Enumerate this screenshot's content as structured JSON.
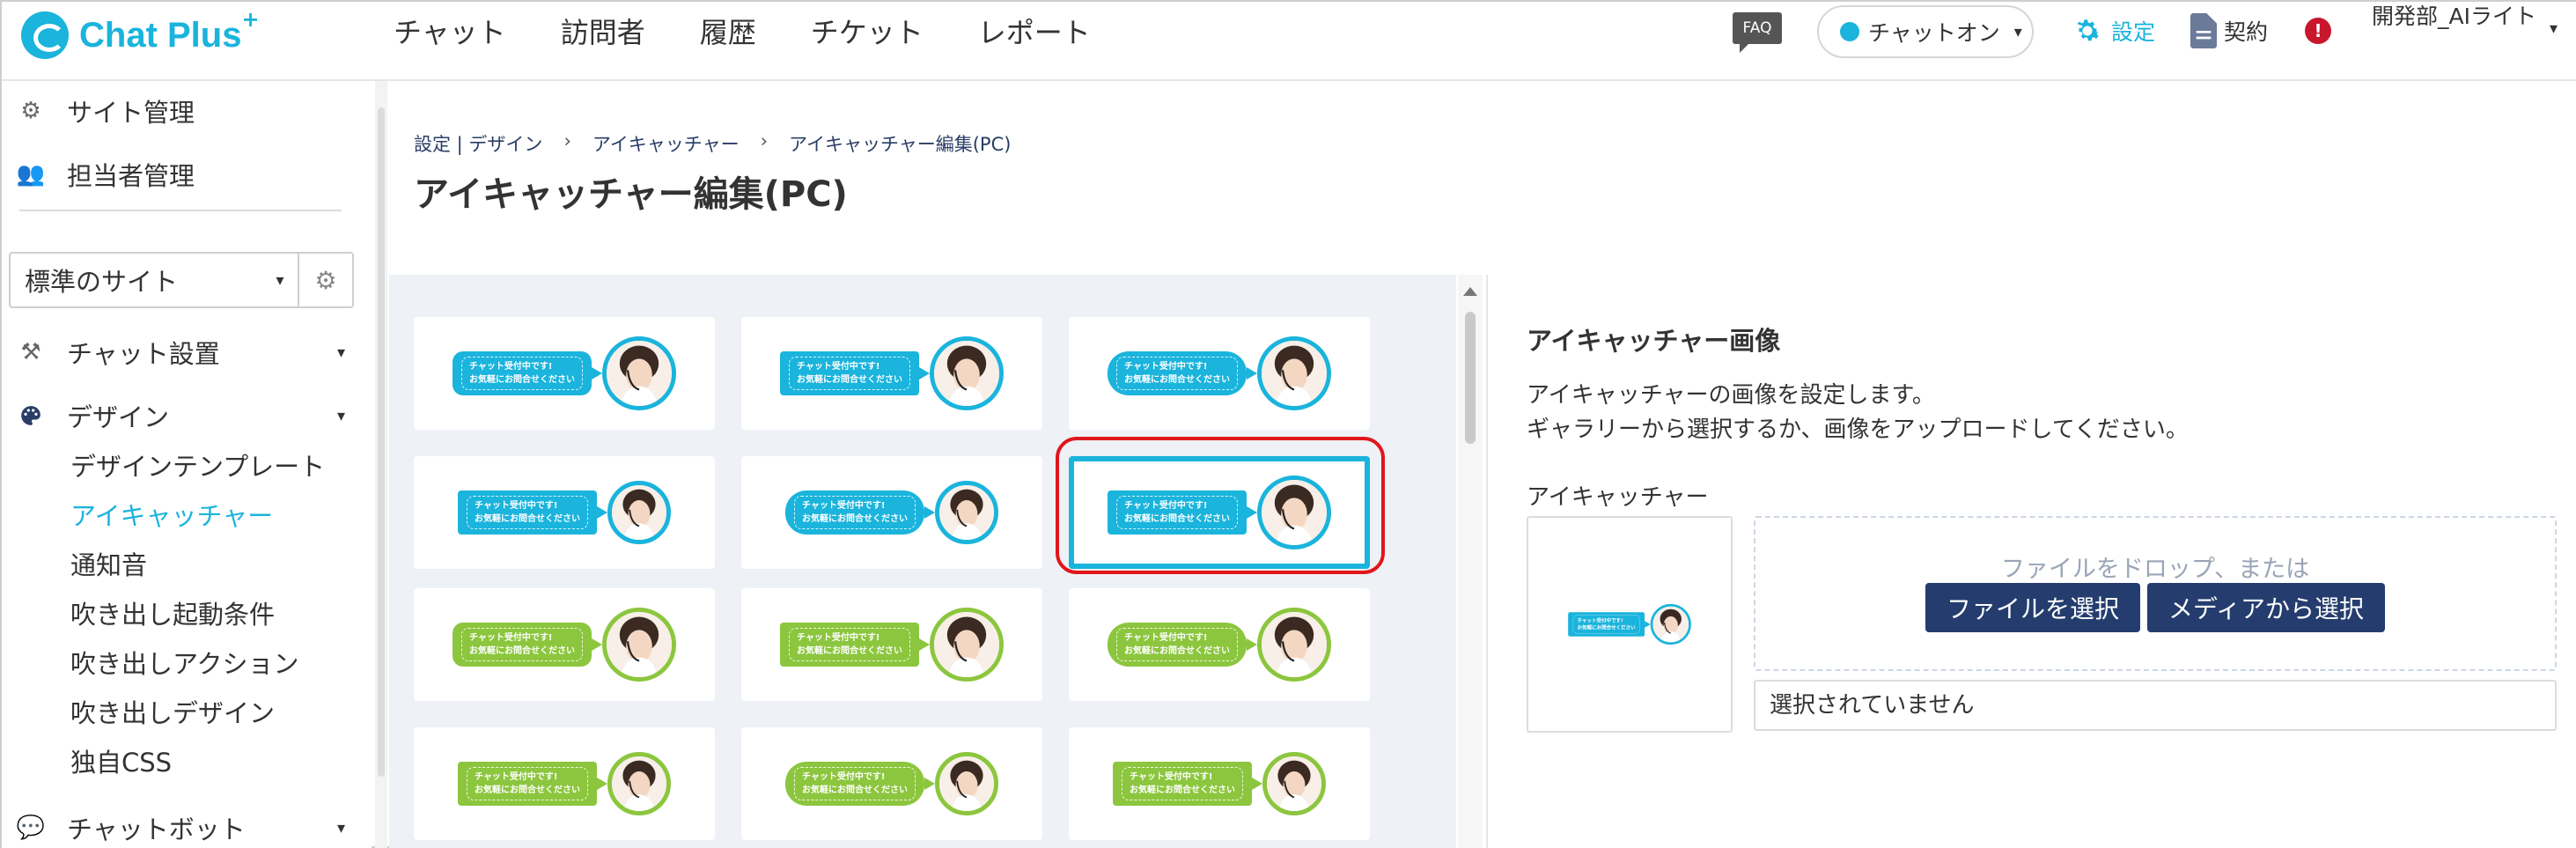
{
  "app": {
    "logo_text": "Chat Plus",
    "logo_plus": "+"
  },
  "top_nav": [
    "チャット",
    "訪問者",
    "履歴",
    "チケット",
    "レポート"
  ],
  "header": {
    "faq": "FAQ",
    "status": "チャットオン",
    "settings": "設定",
    "contract": "契約",
    "alert": "!",
    "user": "開発部_AIライト"
  },
  "sidebar": {
    "site_admin": "サイト管理",
    "staff_admin": "担当者管理",
    "site_select": "標準のサイト",
    "groups": {
      "chat_settings": "チャット設置",
      "design": "デザイン",
      "chatbot": "チャットボット"
    },
    "design_items": [
      {
        "label": "デザインテンプレート",
        "active": false
      },
      {
        "label": "アイキャッチャー",
        "active": true
      },
      {
        "label": "通知音",
        "active": false
      },
      {
        "label": "吹き出し起動条件",
        "active": false
      },
      {
        "label": "吹き出しアクション",
        "active": false
      },
      {
        "label": "吹き出しデザイン",
        "active": false
      },
      {
        "label": "独自CSS",
        "active": false
      }
    ]
  },
  "breadcrumb": [
    "設定 | デザイン",
    "›",
    "アイキャッチャー",
    "›",
    "アイキャッチャー編集(PC)"
  ],
  "page_title": "アイキャッチャー編集(PC)",
  "eyecatchers": {
    "line1": "チャット受付中です!",
    "line2": "お気軽にお問合せください",
    "colors": {
      "blue": "#1ab4dc",
      "green": "#8cc63e"
    },
    "selected_index": 5,
    "items": [
      {
        "color": "blue",
        "style": "rounded"
      },
      {
        "color": "blue",
        "style": "square"
      },
      {
        "color": "blue",
        "style": "oval"
      },
      {
        "color": "blue",
        "style": "square-lg"
      },
      {
        "color": "blue",
        "style": "oval-lg"
      },
      {
        "color": "blue",
        "style": "square-selected"
      },
      {
        "color": "green",
        "style": "rounded"
      },
      {
        "color": "green",
        "style": "square"
      },
      {
        "color": "green",
        "style": "oval"
      },
      {
        "color": "green",
        "style": "square-lg"
      },
      {
        "color": "green",
        "style": "oval-lg"
      },
      {
        "color": "green",
        "style": "square-lg"
      }
    ]
  },
  "panel": {
    "title": "アイキャッチャー画像",
    "desc1": "アイキャッチャーの画像を設定します。",
    "desc2": "ギャラリーから選択するか、画像をアップロードしてください。",
    "field_label": "アイキャッチャー",
    "drop_text": "ファイルをドロップ、または",
    "select_file": "ファイルを選択",
    "select_media": "メディアから選択",
    "file_status": "選択されていません"
  }
}
